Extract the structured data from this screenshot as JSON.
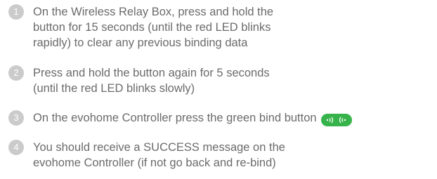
{
  "steps": [
    {
      "number": "1",
      "lines": [
        "On the Wireless Relay Box, press and hold the",
        "button for 15 seconds (until the red LED blinks",
        "rapidly) to clear any previous binding data"
      ]
    },
    {
      "number": "2",
      "lines": [
        "Press and hold the button again for 5 seconds",
        "(until the red LED blinks slowly)"
      ]
    },
    {
      "number": "3",
      "lines": [
        "On the evohome Controller press the green bind button"
      ],
      "icon": "bind-button-icon",
      "icon_color": "#36b34a"
    },
    {
      "number": "4",
      "lines": [
        "You should receive a SUCCESS message on the",
        "evohome Controller (if not go back and re-bind)"
      ]
    }
  ],
  "colors": {
    "text": "#6b6b6b",
    "number_circle": "#cbcbcb",
    "bind_button": "#36b34a"
  }
}
